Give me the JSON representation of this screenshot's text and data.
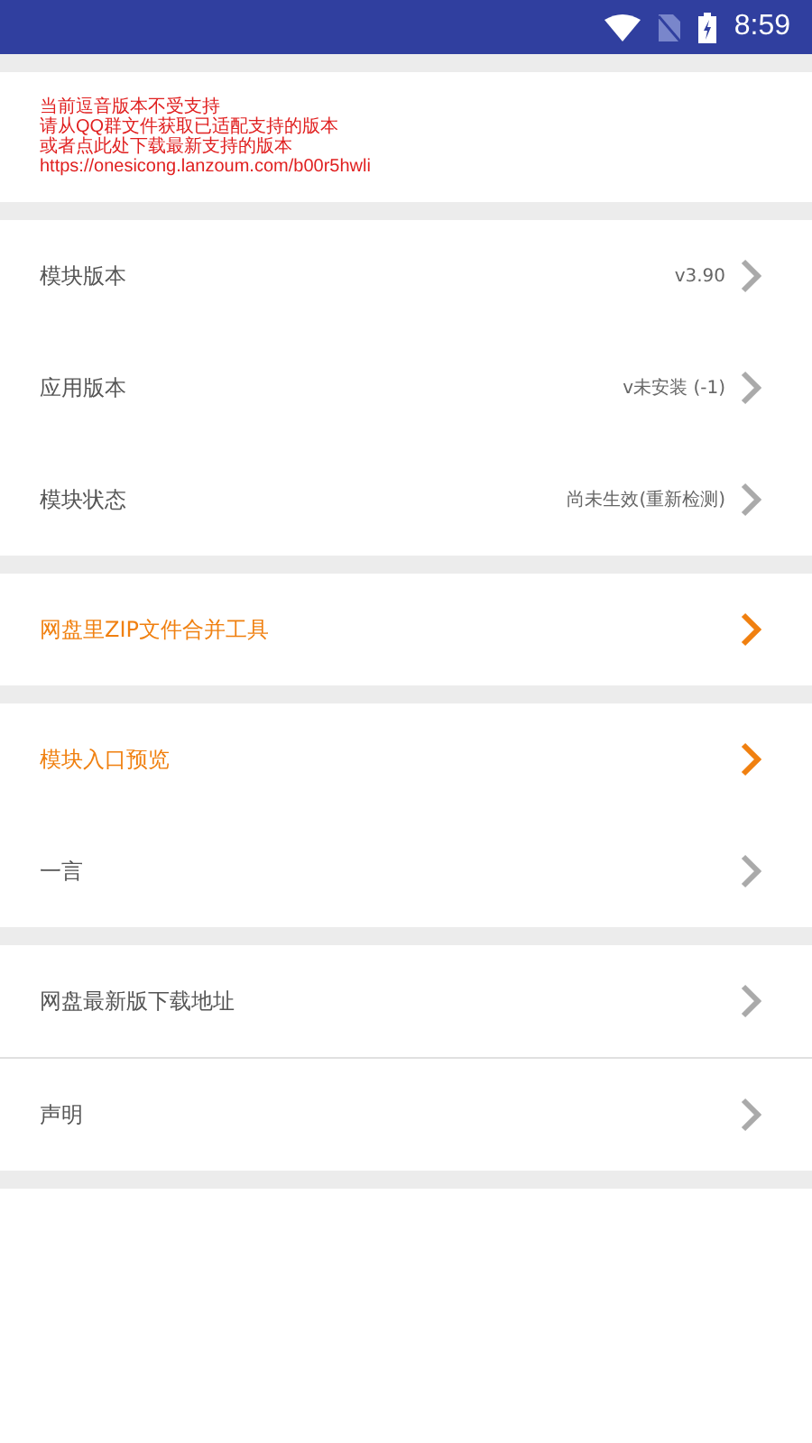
{
  "status_bar": {
    "time": "8:59"
  },
  "notice": {
    "lines": [
      "当前逗音版本不受支持",
      "请从QQ群文件获取已适配支持的版本",
      "或者点此处下载最新支持的版本",
      "https://onesicong.lanzoum.com/b00r5hwli"
    ]
  },
  "sections": [
    {
      "rows": [
        {
          "label": "模块版本",
          "value": "v3.90",
          "accent": false,
          "divider": false
        },
        {
          "label": "应用版本",
          "value": "v未安装 (-1)",
          "accent": false,
          "divider": false
        },
        {
          "label": "模块状态",
          "value": "尚未生效(重新检测)",
          "accent": false,
          "divider": false
        }
      ]
    },
    {
      "rows": [
        {
          "label": "网盘里ZIP文件合并工具",
          "accent": true,
          "divider": false
        }
      ]
    },
    {
      "rows": [
        {
          "label": "模块入口预览",
          "accent": true,
          "divider": false
        },
        {
          "label": "一言",
          "accent": false,
          "divider": false
        }
      ]
    },
    {
      "rows": [
        {
          "label": "网盘最新版下载地址",
          "accent": false,
          "divider": false
        },
        {
          "label": "声明",
          "accent": false,
          "divider": true
        }
      ]
    }
  ]
}
